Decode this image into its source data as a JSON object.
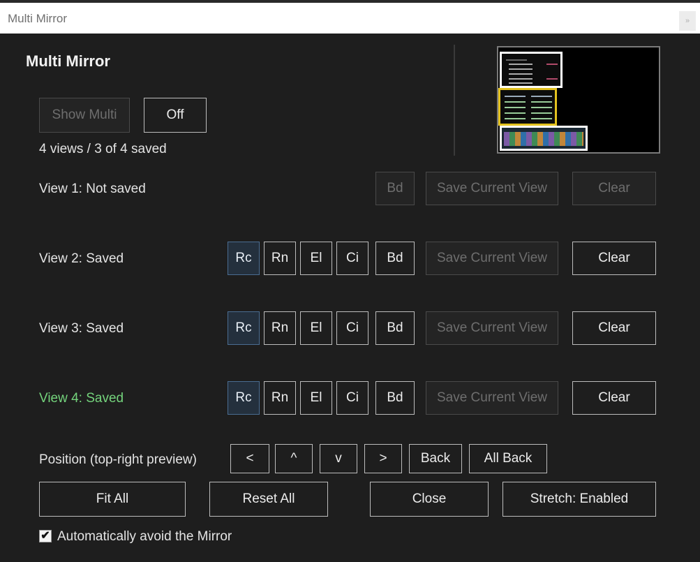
{
  "window": {
    "title": "Multi Mirror",
    "close_glyph": "»"
  },
  "panel": {
    "heading": "Multi Mirror"
  },
  "top_buttons": {
    "show_multi": "Show Multi",
    "off": "Off"
  },
  "status": "4 views / 3 of 4 saved",
  "views": [
    {
      "label": "View 1: Not saved",
      "tags": [],
      "bd": "Bd",
      "save": "Save Current View",
      "clear": "Clear"
    },
    {
      "label": "View 2: Saved",
      "tags": [
        "Rc",
        "Rn",
        "El",
        "Ci"
      ],
      "bd": "Bd",
      "save": "Save Current View",
      "clear": "Clear"
    },
    {
      "label": "View 3: Saved",
      "tags": [
        "Rc",
        "Rn",
        "El",
        "Ci"
      ],
      "bd": "Bd",
      "save": "Save Current View",
      "clear": "Clear"
    },
    {
      "label": "View 4: Saved",
      "tags": [
        "Rc",
        "Rn",
        "El",
        "Ci"
      ],
      "bd": "Bd",
      "save": "Save Current View",
      "clear": "Clear"
    }
  ],
  "position": {
    "label": "Position (top-right preview)",
    "left": "<",
    "up": "^",
    "down": "v",
    "right": ">",
    "back": "Back",
    "all_back": "All Back"
  },
  "actions": {
    "fit_all": "Fit All",
    "reset_all": "Reset All",
    "close": "Close",
    "stretch": "Stretch: Enabled"
  },
  "auto_avoid": {
    "label": "Automatically avoid the Mirror",
    "checked": true,
    "check_glyph": "✔"
  },
  "colors": {
    "active_view": "#74d37c",
    "preview_highlight": "#e3c21f",
    "selected_tag": "#24303d"
  }
}
